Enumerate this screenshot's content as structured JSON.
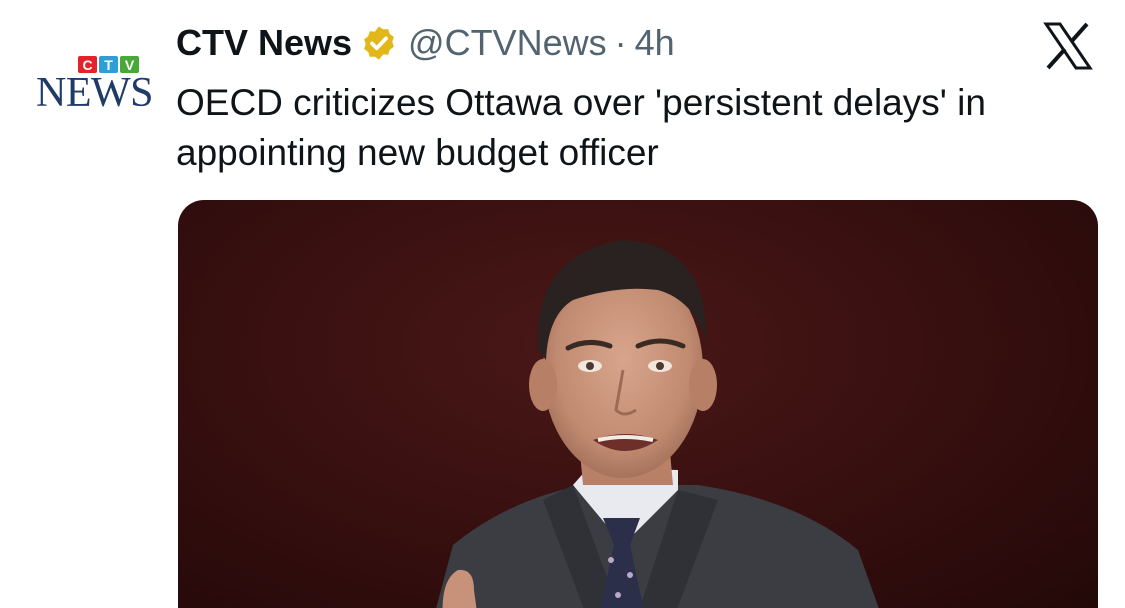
{
  "tweet": {
    "author": {
      "display_name": "CTV News",
      "handle": "@CTVNews",
      "verified": true,
      "avatar_icon": "ctv-news-logo",
      "avatar_letters": [
        "C",
        "T",
        "V"
      ],
      "avatar_letter_colors": [
        "#e3232b",
        "#2c9fd6",
        "#48a938"
      ],
      "avatar_word": "NEWS"
    },
    "separator": "·",
    "timestamp": "4h",
    "text": "OECD criticizes Ottawa over 'persistent delays' in appointing new budget officer",
    "media": {
      "type": "photo",
      "icon": "news-photo"
    }
  },
  "platform": {
    "logo_icon": "x-logo"
  },
  "colors": {
    "text_primary": "#0f1419",
    "text_secondary": "#536471",
    "verified_gold": "#e2b719",
    "news_navy": "#1f3b67",
    "media_background": "#3a1010"
  }
}
